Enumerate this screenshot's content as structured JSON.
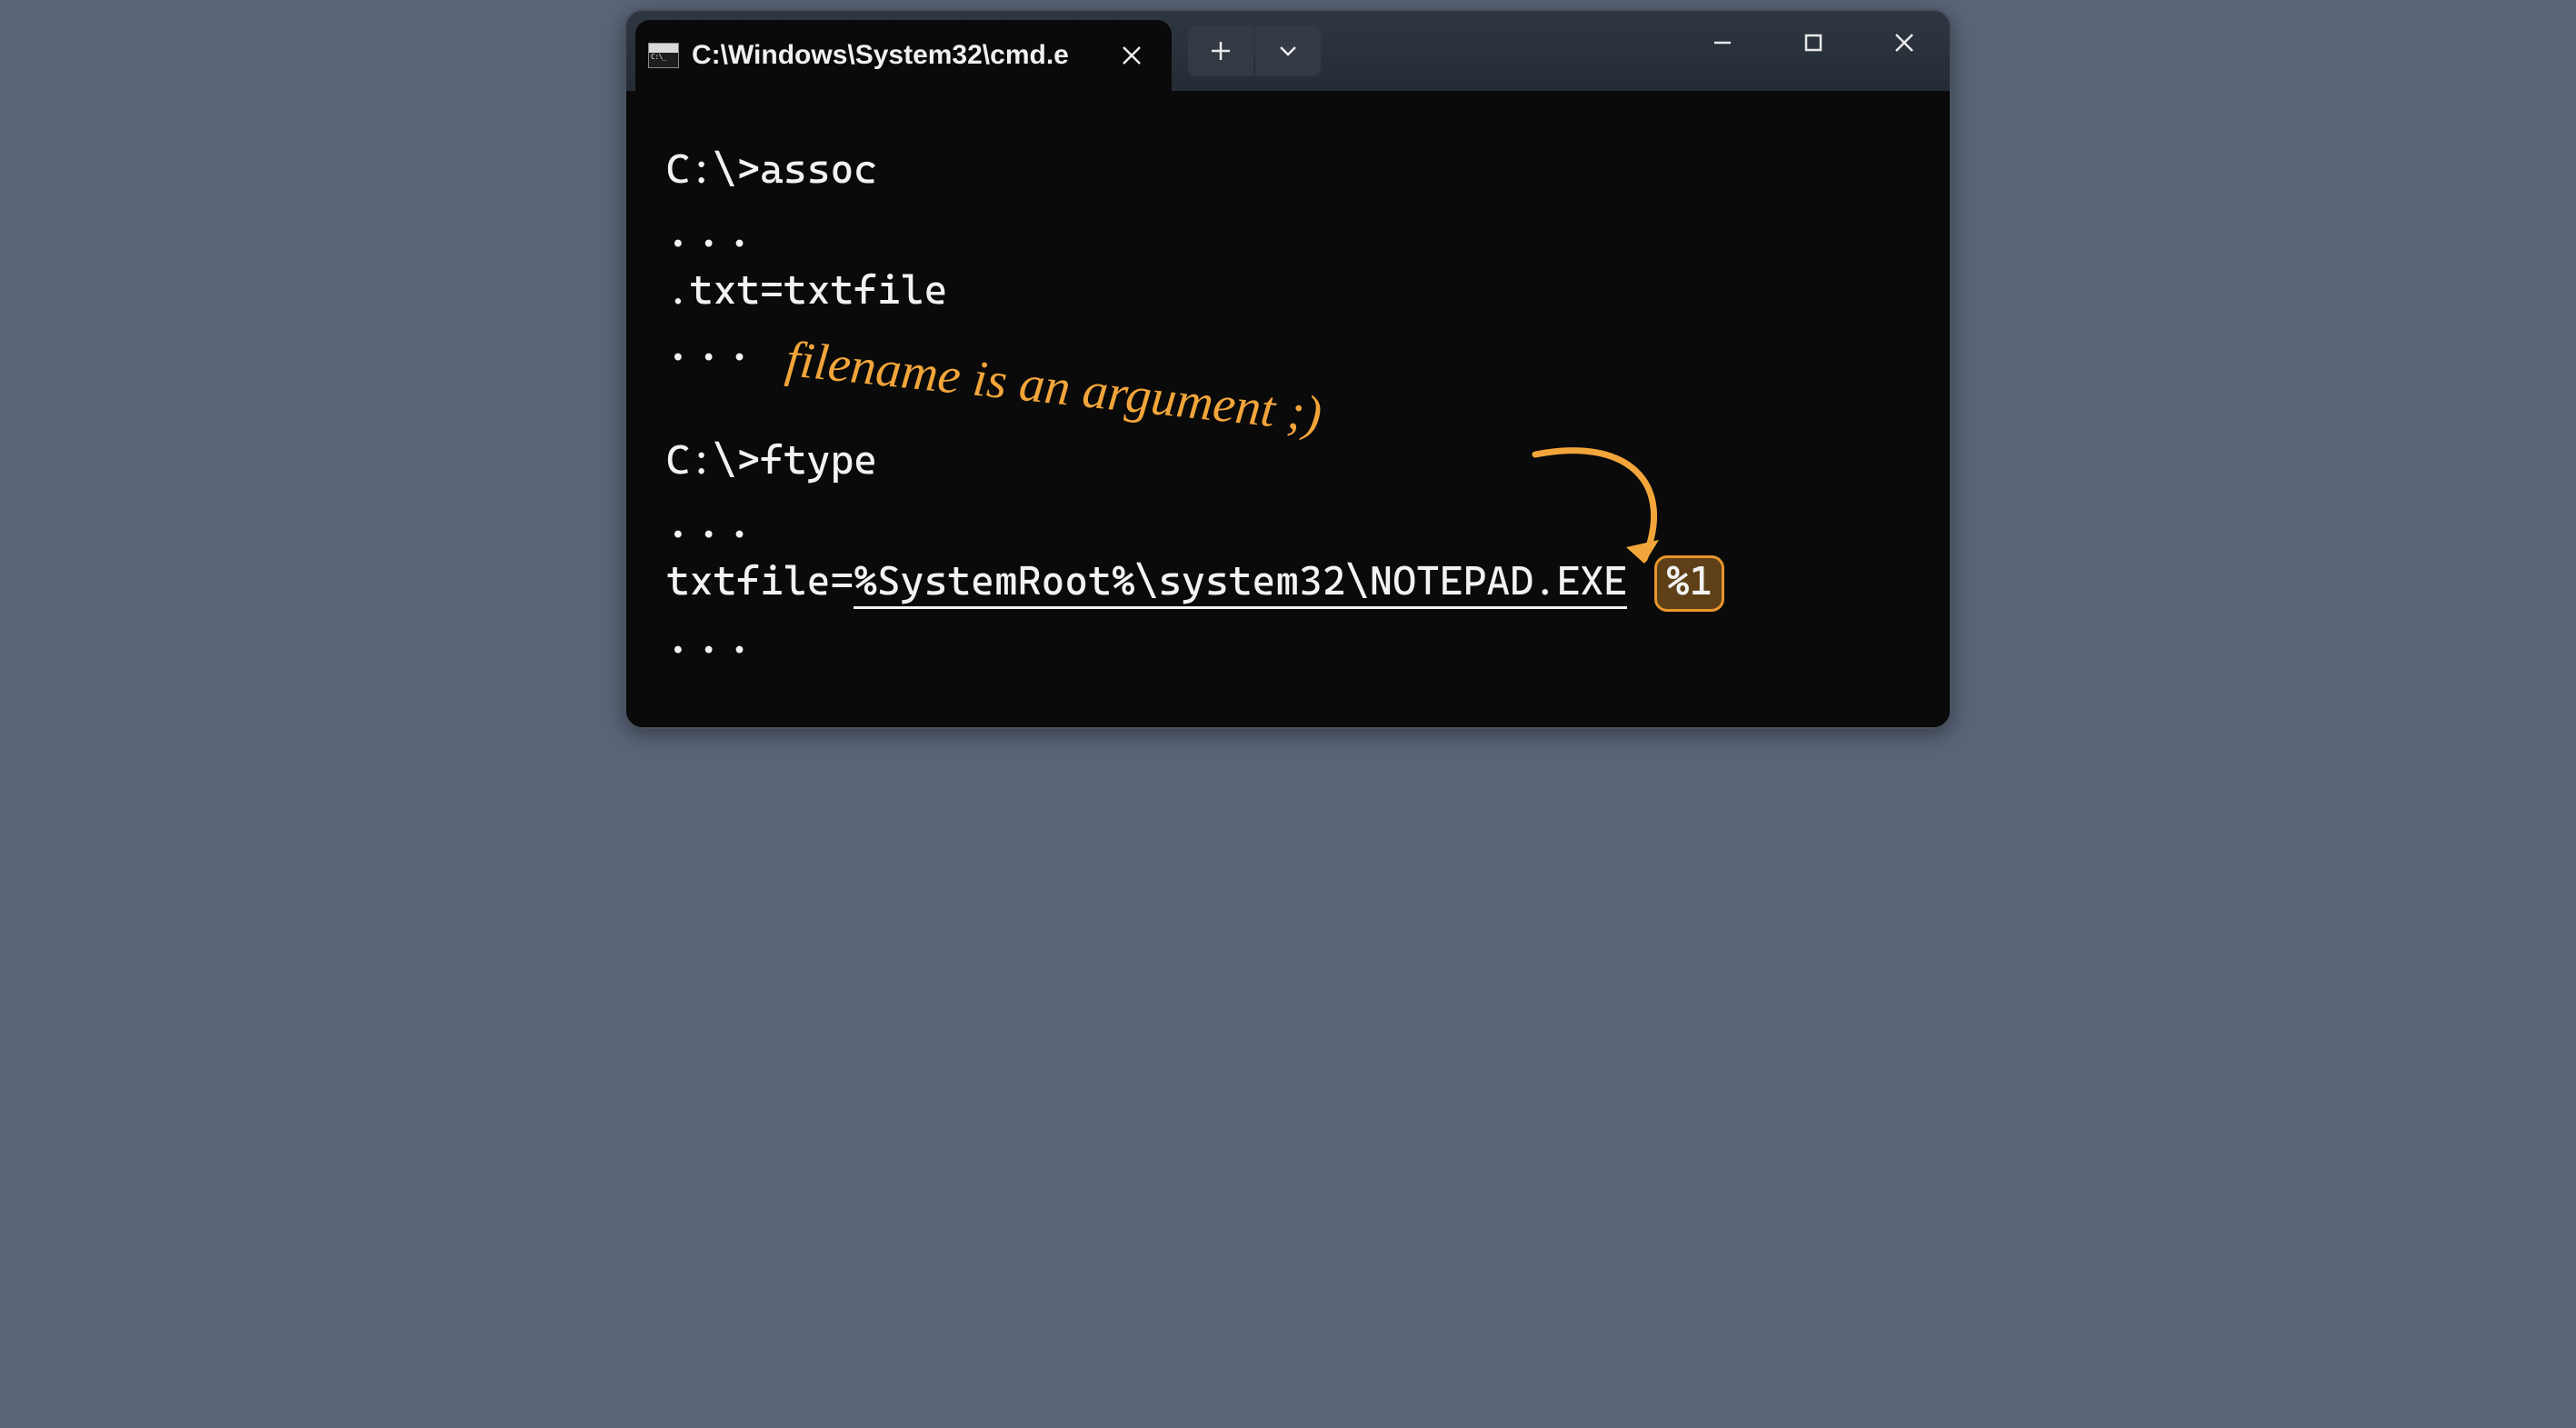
{
  "titlebar": {
    "tab_title": "C:\\Windows\\System32\\cmd.e",
    "close_glyph": "✕",
    "new_tab_glyph": "＋",
    "tabs_menu_glyph": "⌄"
  },
  "window_controls": {
    "minimize": "—",
    "maximize": "▢",
    "close": "✕"
  },
  "terminal": {
    "lines": {
      "l1_prompt": "C:\\>",
      "l1_cmd": "assoc",
      "l2": "...",
      "l3": ".txt=txtfile",
      "l4": "...",
      "l5_prompt": "C:\\>",
      "l5_cmd": "ftype",
      "l6": "...",
      "l7_prefix": "txtfile=",
      "l7_path": "%SystemRoot%\\system32\\NOTEPAD.EXE",
      "l7_arg": "%1",
      "l8": "..."
    }
  },
  "annotation": {
    "text": "filename is an argument ;)",
    "color": "#f2a53a"
  }
}
